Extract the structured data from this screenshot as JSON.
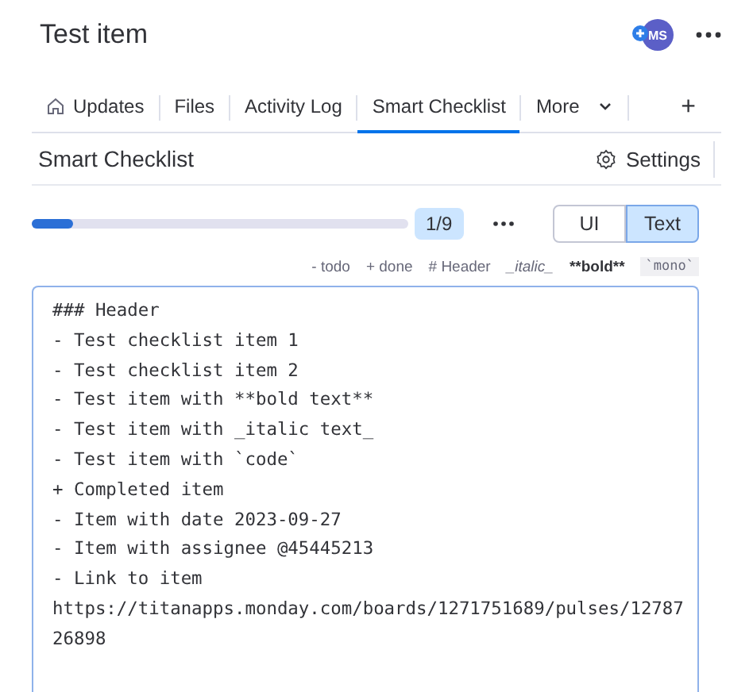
{
  "title": "Test item",
  "avatar": {
    "initials": "MS"
  },
  "tabs": [
    {
      "label": "Updates",
      "kind": "home",
      "selected": false
    },
    {
      "label": "Files",
      "kind": "plain",
      "selected": false
    },
    {
      "label": "Activity Log",
      "kind": "plain",
      "selected": false
    },
    {
      "label": "Smart Checklist",
      "kind": "plain",
      "selected": true
    },
    {
      "label": "More",
      "kind": "dropdown",
      "selected": false
    }
  ],
  "add_tab": "+",
  "section": {
    "title": "Smart Checklist",
    "settings": "Settings"
  },
  "progress": {
    "level": 0.11,
    "count": "1/9"
  },
  "view_toggle": [
    {
      "label": "UI",
      "selected": false
    },
    {
      "label": "Text",
      "selected": true
    }
  ],
  "format_hints": [
    {
      "label": "- todo",
      "kind": "plain"
    },
    {
      "label": "+ done",
      "kind": "plain"
    },
    {
      "label": "# Header",
      "kind": "plain"
    },
    {
      "label": "_italic_",
      "kind": "italic"
    },
    {
      "label": "**bold**",
      "kind": "bold"
    },
    {
      "label": "`mono`",
      "kind": "mono"
    }
  ],
  "editor_lines": [
    "### Header",
    "- Test checklist item 1",
    "- Test checklist item 2",
    "- Test item with **bold text**",
    "- Test item with _italic text_",
    "- Test item with `code`",
    "+ Completed item",
    "- Item with date 2023-09-27",
    "- Item with assignee @45445213",
    "- Link to item",
    "https://titanapps.monday.com/boards/1271751689/pulses/12787",
    "26898"
  ]
}
